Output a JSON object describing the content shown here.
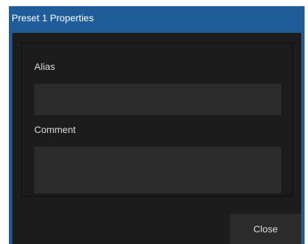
{
  "dialog": {
    "title": "Preset 1 Properties",
    "accent_color": "#1e5d9a"
  },
  "fields": {
    "alias": {
      "label": "Alias",
      "value": "",
      "placeholder": ""
    },
    "comment": {
      "label": "Comment",
      "value": "",
      "placeholder": ""
    }
  },
  "footer": {
    "close_label": "Close"
  }
}
